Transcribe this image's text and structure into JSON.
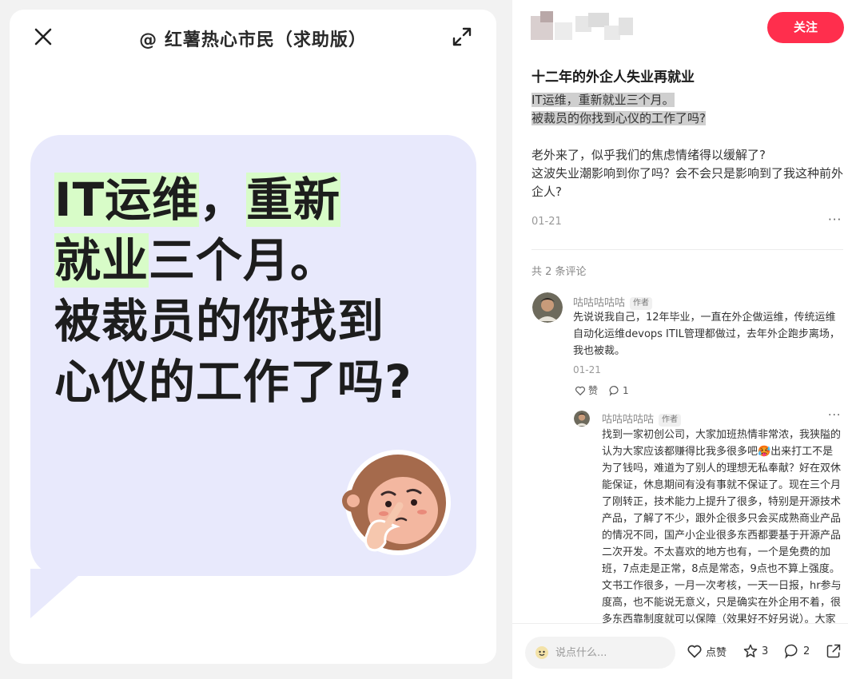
{
  "card": {
    "title": "@ 红薯热心市民（求助版）",
    "headline_line1_a": "IT运维",
    "headline_line1_b": "，",
    "headline_line1_c": "重新",
    "headline_line2_a": "就业",
    "headline_line2_b": "三个月。",
    "headline_line3": "被裁员的你找到",
    "headline_line4": "心仪的工作了吗?"
  },
  "header": {
    "follow_label": "关注"
  },
  "post": {
    "title": "十二年的外企人失业再就业",
    "quote_line1": "IT运维，重新就业三个月。",
    "quote_line2": "被裁员的你找到心仪的工作了吗?",
    "para_line1": "老外来了，似乎我们的焦虑情绪得以缓解了?",
    "para_line2": "这波失业潮影响到你了吗？会不会只是影响到了我这种前外企人?",
    "date": "01-21",
    "more": "···"
  },
  "comments": {
    "count_label": "共 2 条评论",
    "items": [
      {
        "name": "咕咕咕咕咕",
        "tag": "作者",
        "text": "先说说我自己，12年毕业，一直在外企做运维，传统运维自动化运维devops ITIL管理都做过，去年外企跑步离场，我也被裁。",
        "date": "01-21",
        "like_label": "赞",
        "reply_count": "1"
      },
      {
        "name": "咕咕咕咕咕",
        "tag": "作者",
        "text": "找到一家初创公司，大家加班热情非常浓，我狭隘的认为大家应该都赚得比我多很多吧🥵出来打工不是为了钱吗，难道为了别人的理想无私奉献？好在双休能保证，休息期间有没有事就不保证了。现在三个月了刚转正，技术能力上提升了很多，特别是开源技术产品，了解了不少，跟外企很多只会买成熟商业产品的情况不同，国产小企业很多东西都要基于开源产品二次开发。不太喜欢的地方也有，一个是免费的加班，7点走是正常，8点是常态，9点也不算上强度。文书工作很多，一月一次考核，一天一日报，hr参与度高，也不能说无意义，只是确实在外企用不着，很多东西靠制度就可以保障（效果好不好另说）。大家",
        "more": "···"
      }
    ]
  },
  "bottom_bar": {
    "input_placeholder": "说点什么...",
    "like_label": "点赞",
    "collect_count": "3",
    "comment_count": "2"
  },
  "colors": {
    "accent": "#ff2e4d",
    "bubble": "#e8e9fc",
    "highlight": "#d8fcc8"
  }
}
